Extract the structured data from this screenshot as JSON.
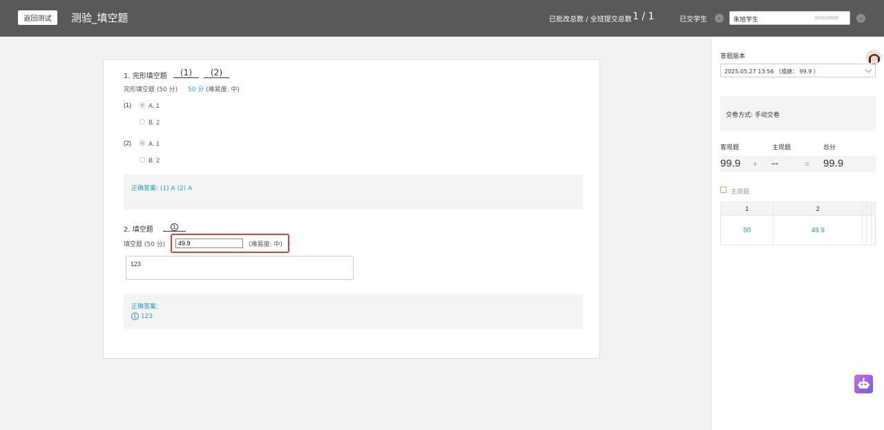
{
  "header": {
    "back_label": "返回测试",
    "title": "测验_填空题",
    "graded_label": "已批改总数 / 全班提交总数",
    "graded_count": "1 / 1",
    "submitted_label": "已交学生",
    "student_name": "朱旭学生",
    "student_id": "zxstudent"
  },
  "questions": {
    "q1": {
      "title": "1.   完形填空题",
      "blank1": "(1)",
      "blank2": "(2)",
      "meta": "完形填空题 (50 分)",
      "score": "50 分",
      "difficulty": "(难易度: 中)",
      "sub1_num": "(1)",
      "sub2_num": "(2)",
      "opt_a": "A. 1",
      "opt_b": "B. 2",
      "answer": "正确答案: (1) A    (2) A"
    },
    "q2": {
      "title": "2.   填空题",
      "blank1": "1",
      "meta": "填空题 (50 分)",
      "score_value": "49.9",
      "difficulty": "(难易度: 中)",
      "response": "123",
      "answer_label": "正确答案:",
      "answer_num": "1",
      "answer_value": "123"
    }
  },
  "panel": {
    "version_label": "答题版本",
    "version_value": "2025.05.27 13:56 （成绩： 99.9 ）",
    "submit_method": "交卷方式: 手动交卷",
    "objective_label": "客观题",
    "subjective_label": "主观题",
    "total_label": "总分",
    "objective_score": "99.9",
    "plus": "+",
    "subjective_score": "--",
    "equals": "=",
    "total_score": "99.9",
    "legend_label": "主观题",
    "grid_headers": [
      "1",
      "2",
      "",
      "",
      ""
    ],
    "grid_values": [
      "50",
      "49.9",
      "",
      "",
      ""
    ]
  },
  "colors": {
    "header_bg": "#58595b",
    "accent": "#1aa0c8",
    "highlight": "#e53935"
  }
}
